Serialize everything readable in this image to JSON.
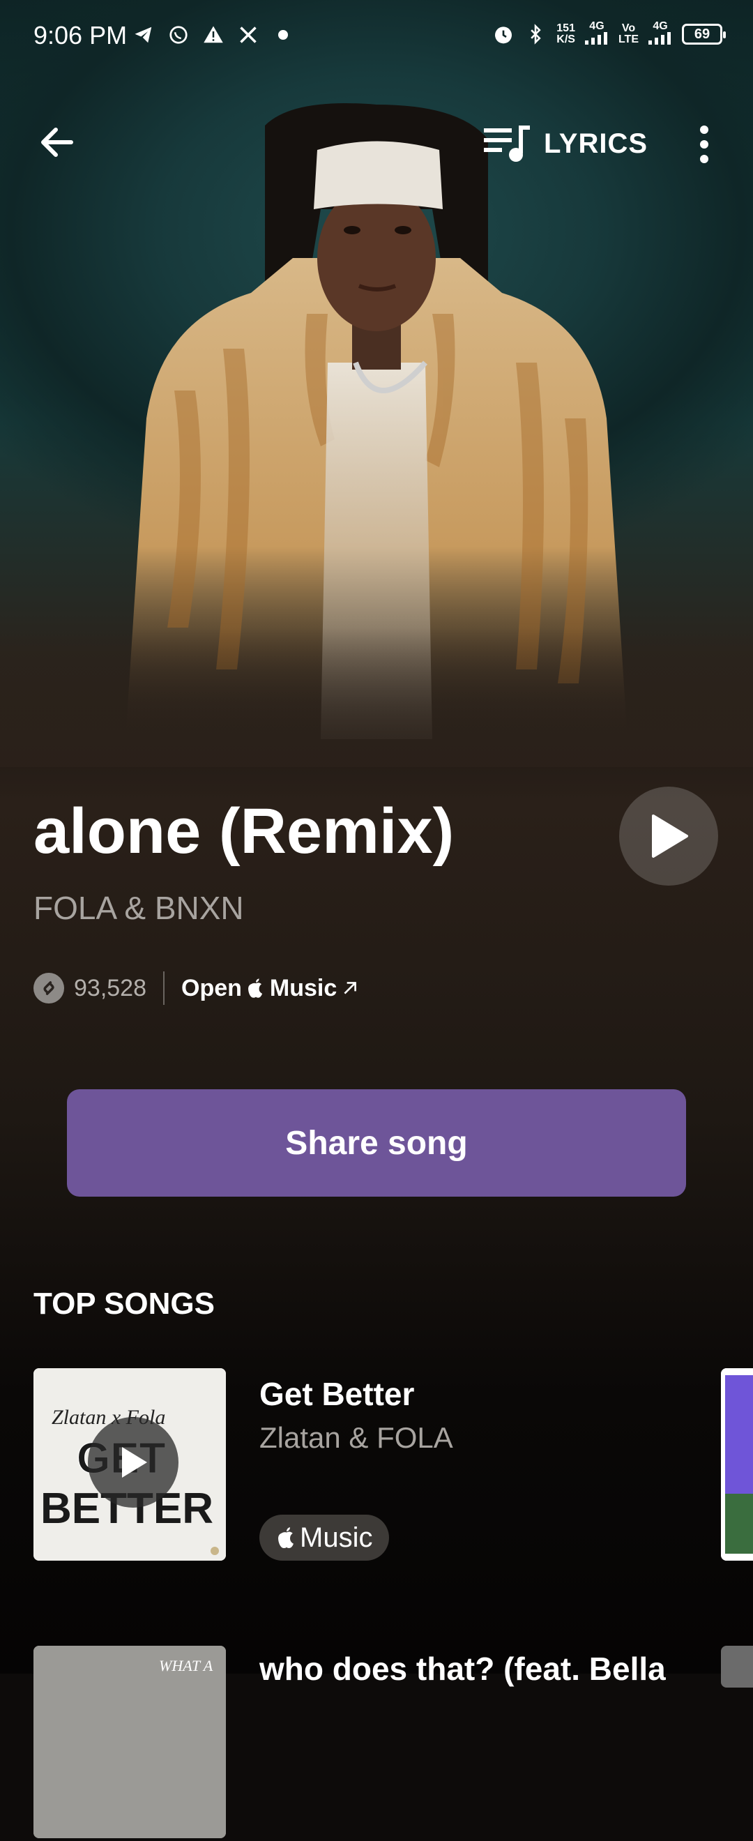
{
  "status_bar": {
    "time": "9:06 PM",
    "net_speed_top": "151",
    "net_speed_bottom": "K/S",
    "sim1": "4G",
    "volte_top": "Vo",
    "volte_bottom": "LTE",
    "sim2": "4G",
    "battery": "69"
  },
  "header": {
    "back_icon": "arrow-left-icon",
    "lyrics_label": "LYRICS",
    "more_icon": "more-vertical-icon"
  },
  "track": {
    "title": "alone (Remix)",
    "artist": "FOLA & BNXN",
    "shazam_count": "93,528",
    "open_label": "Open",
    "music_label": "Music"
  },
  "share_button": "Share song",
  "top_songs": {
    "title": "TOP SONGS",
    "items": [
      {
        "title": "Get Better",
        "artist": "Zlatan & FOLA",
        "badge": "Music",
        "art_text_top": "Zlatan x Fola",
        "art_text_main1": "GET",
        "art_text_main2": "BETTER"
      },
      {
        "title": "who does that? (feat. Bella",
        "art_text": "WHAT A"
      }
    ]
  },
  "colors": {
    "accent": "#6e5599",
    "hero_teal": "#1f4a4c",
    "background": "#0d0b0a"
  }
}
